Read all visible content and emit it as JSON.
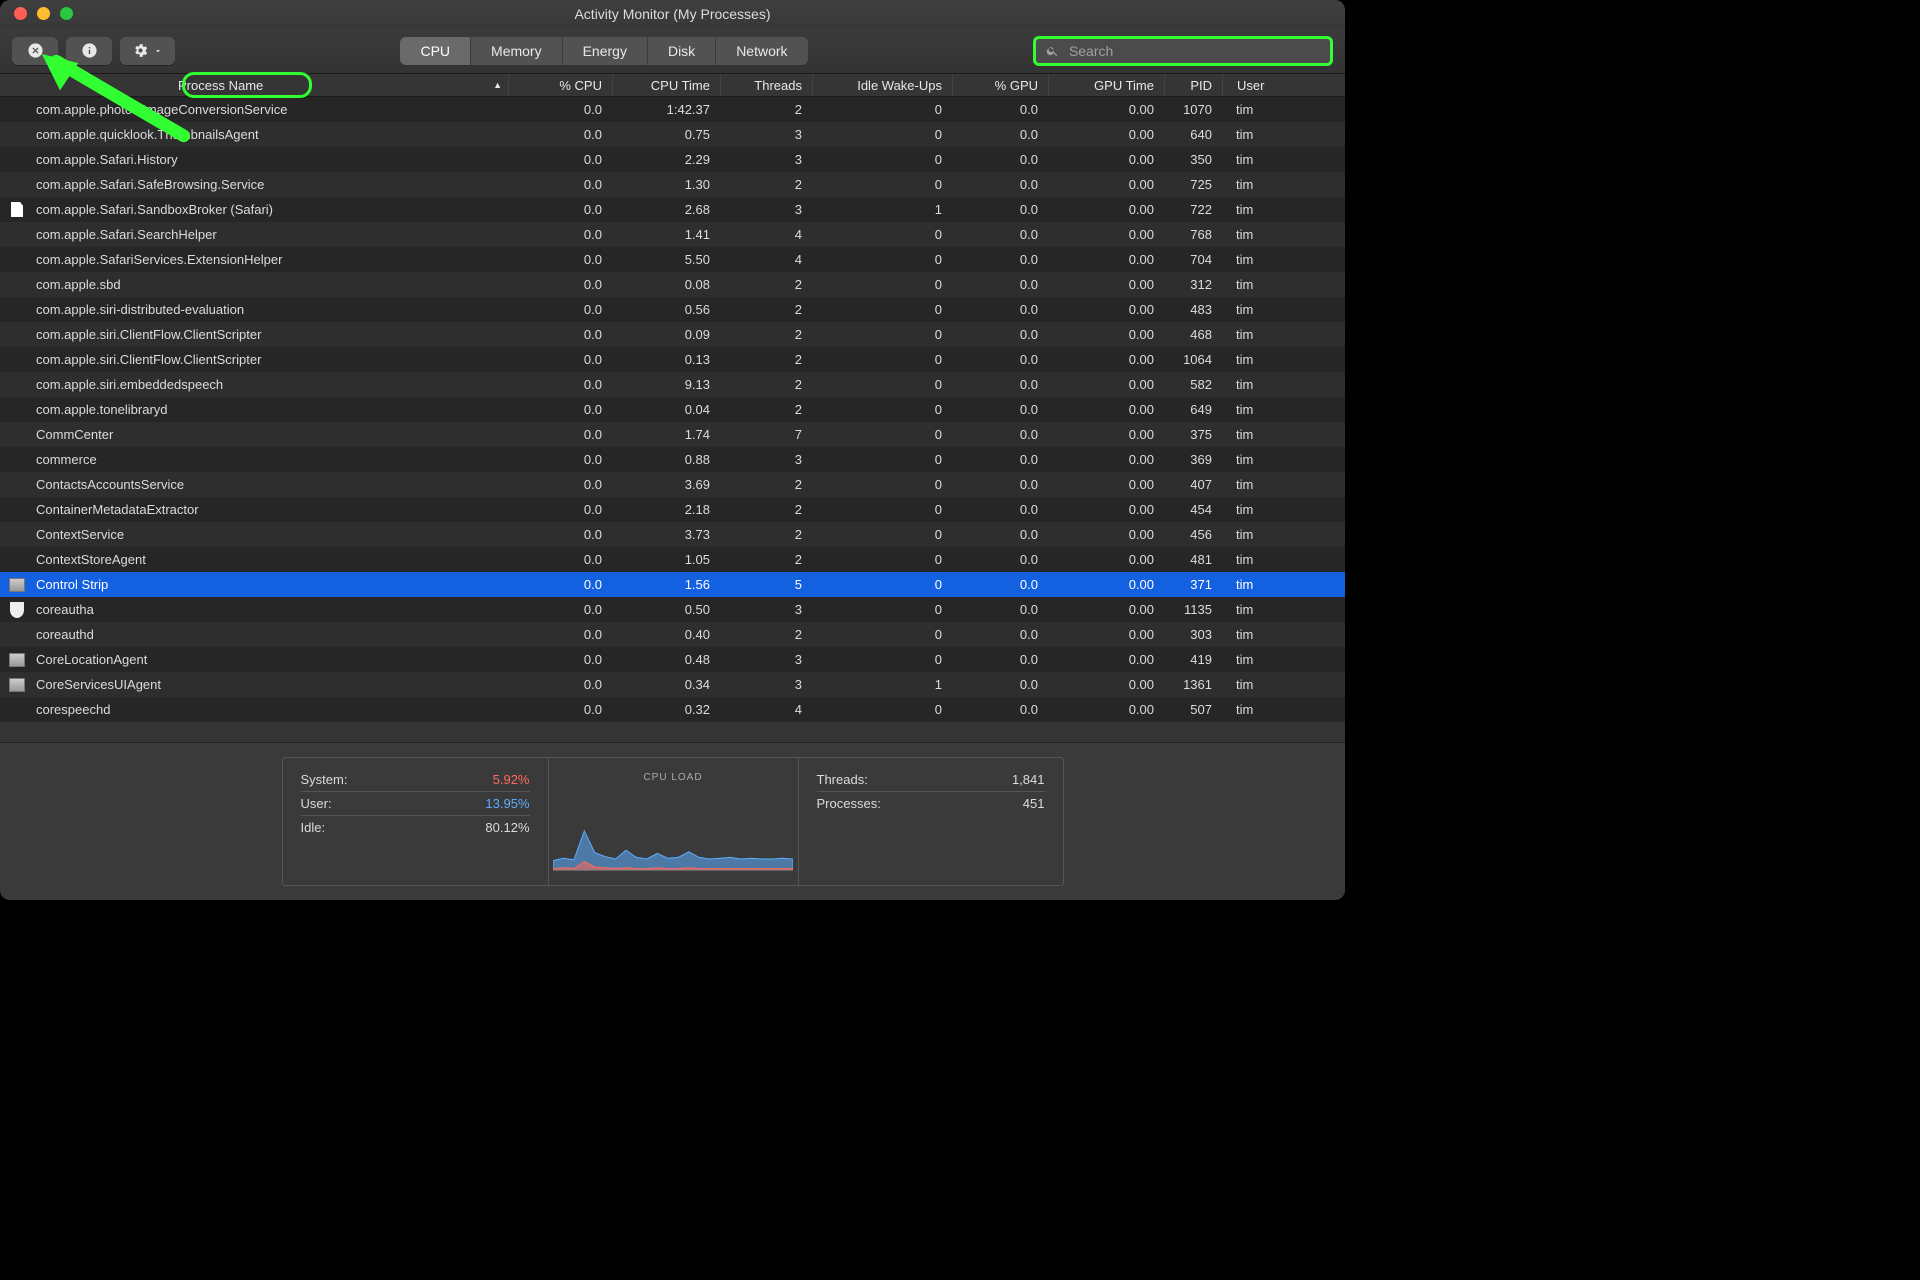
{
  "window_title": "Activity Monitor (My Processes)",
  "tabs": [
    "CPU",
    "Memory",
    "Energy",
    "Disk",
    "Network"
  ],
  "tabs_selected_index": 0,
  "search_placeholder": "Search",
  "columns": {
    "name": "Process Name",
    "cpu": "% CPU",
    "cputime": "CPU Time",
    "threads": "Threads",
    "wakeups": "Idle Wake-Ups",
    "gpu": "% GPU",
    "gputime": "GPU Time",
    "pid": "PID",
    "user": "User"
  },
  "sort_indicator": "▲",
  "processes": [
    {
      "icon": "",
      "name": "com.apple.photos.ImageConversionService",
      "cpu": "0.0",
      "cputime": "1:42.37",
      "threads": "2",
      "wakeups": "0",
      "gpu": "0.0",
      "gputime": "0.00",
      "pid": "1070",
      "user": "tim"
    },
    {
      "icon": "",
      "name": "com.apple.quicklook.ThumbnailsAgent",
      "cpu": "0.0",
      "cputime": "0.75",
      "threads": "3",
      "wakeups": "0",
      "gpu": "0.0",
      "gputime": "0.00",
      "pid": "640",
      "user": "tim"
    },
    {
      "icon": "",
      "name": "com.apple.Safari.History",
      "cpu": "0.0",
      "cputime": "2.29",
      "threads": "3",
      "wakeups": "0",
      "gpu": "0.0",
      "gputime": "0.00",
      "pid": "350",
      "user": "tim"
    },
    {
      "icon": "",
      "name": "com.apple.Safari.SafeBrowsing.Service",
      "cpu": "0.0",
      "cputime": "1.30",
      "threads": "2",
      "wakeups": "0",
      "gpu": "0.0",
      "gputime": "0.00",
      "pid": "725",
      "user": "tim"
    },
    {
      "icon": "doc",
      "name": "com.apple.Safari.SandboxBroker (Safari)",
      "cpu": "0.0",
      "cputime": "2.68",
      "threads": "3",
      "wakeups": "1",
      "gpu": "0.0",
      "gputime": "0.00",
      "pid": "722",
      "user": "tim"
    },
    {
      "icon": "",
      "name": "com.apple.Safari.SearchHelper",
      "cpu": "0.0",
      "cputime": "1.41",
      "threads": "4",
      "wakeups": "0",
      "gpu": "0.0",
      "gputime": "0.00",
      "pid": "768",
      "user": "tim"
    },
    {
      "icon": "",
      "name": "com.apple.SafariServices.ExtensionHelper",
      "cpu": "0.0",
      "cputime": "5.50",
      "threads": "4",
      "wakeups": "0",
      "gpu": "0.0",
      "gputime": "0.00",
      "pid": "704",
      "user": "tim"
    },
    {
      "icon": "",
      "name": "com.apple.sbd",
      "cpu": "0.0",
      "cputime": "0.08",
      "threads": "2",
      "wakeups": "0",
      "gpu": "0.0",
      "gputime": "0.00",
      "pid": "312",
      "user": "tim"
    },
    {
      "icon": "",
      "name": "com.apple.siri-distributed-evaluation",
      "cpu": "0.0",
      "cputime": "0.56",
      "threads": "2",
      "wakeups": "0",
      "gpu": "0.0",
      "gputime": "0.00",
      "pid": "483",
      "user": "tim"
    },
    {
      "icon": "",
      "name": "com.apple.siri.ClientFlow.ClientScripter",
      "cpu": "0.0",
      "cputime": "0.09",
      "threads": "2",
      "wakeups": "0",
      "gpu": "0.0",
      "gputime": "0.00",
      "pid": "468",
      "user": "tim"
    },
    {
      "icon": "",
      "name": "com.apple.siri.ClientFlow.ClientScripter",
      "cpu": "0.0",
      "cputime": "0.13",
      "threads": "2",
      "wakeups": "0",
      "gpu": "0.0",
      "gputime": "0.00",
      "pid": "1064",
      "user": "tim"
    },
    {
      "icon": "",
      "name": "com.apple.siri.embeddedspeech",
      "cpu": "0.0",
      "cputime": "9.13",
      "threads": "2",
      "wakeups": "0",
      "gpu": "0.0",
      "gputime": "0.00",
      "pid": "582",
      "user": "tim"
    },
    {
      "icon": "",
      "name": "com.apple.tonelibraryd",
      "cpu": "0.0",
      "cputime": "0.04",
      "threads": "2",
      "wakeups": "0",
      "gpu": "0.0",
      "gputime": "0.00",
      "pid": "649",
      "user": "tim"
    },
    {
      "icon": "",
      "name": "CommCenter",
      "cpu": "0.0",
      "cputime": "1.74",
      "threads": "7",
      "wakeups": "0",
      "gpu": "0.0",
      "gputime": "0.00",
      "pid": "375",
      "user": "tim"
    },
    {
      "icon": "",
      "name": "commerce",
      "cpu": "0.0",
      "cputime": "0.88",
      "threads": "3",
      "wakeups": "0",
      "gpu": "0.0",
      "gputime": "0.00",
      "pid": "369",
      "user": "tim"
    },
    {
      "icon": "",
      "name": "ContactsAccountsService",
      "cpu": "0.0",
      "cputime": "3.69",
      "threads": "2",
      "wakeups": "0",
      "gpu": "0.0",
      "gputime": "0.00",
      "pid": "407",
      "user": "tim"
    },
    {
      "icon": "",
      "name": "ContainerMetadataExtractor",
      "cpu": "0.0",
      "cputime": "2.18",
      "threads": "2",
      "wakeups": "0",
      "gpu": "0.0",
      "gputime": "0.00",
      "pid": "454",
      "user": "tim"
    },
    {
      "icon": "",
      "name": "ContextService",
      "cpu": "0.0",
      "cputime": "3.73",
      "threads": "2",
      "wakeups": "0",
      "gpu": "0.0",
      "gputime": "0.00",
      "pid": "456",
      "user": "tim"
    },
    {
      "icon": "",
      "name": "ContextStoreAgent",
      "cpu": "0.0",
      "cputime": "1.05",
      "threads": "2",
      "wakeups": "0",
      "gpu": "0.0",
      "gputime": "0.00",
      "pid": "481",
      "user": "tim"
    },
    {
      "icon": "chart",
      "selected": true,
      "name": "Control Strip",
      "cpu": "0.0",
      "cputime": "1.56",
      "threads": "5",
      "wakeups": "0",
      "gpu": "0.0",
      "gputime": "0.00",
      "pid": "371",
      "user": "tim"
    },
    {
      "icon": "shield",
      "name": "coreautha",
      "cpu": "0.0",
      "cputime": "0.50",
      "threads": "3",
      "wakeups": "0",
      "gpu": "0.0",
      "gputime": "0.00",
      "pid": "1135",
      "user": "tim"
    },
    {
      "icon": "",
      "name": "coreauthd",
      "cpu": "0.0",
      "cputime": "0.40",
      "threads": "2",
      "wakeups": "0",
      "gpu": "0.0",
      "gputime": "0.00",
      "pid": "303",
      "user": "tim"
    },
    {
      "icon": "chart",
      "name": "CoreLocationAgent",
      "cpu": "0.0",
      "cputime": "0.48",
      "threads": "3",
      "wakeups": "0",
      "gpu": "0.0",
      "gputime": "0.00",
      "pid": "419",
      "user": "tim"
    },
    {
      "icon": "chart",
      "name": "CoreServicesUIAgent",
      "cpu": "0.0",
      "cputime": "0.34",
      "threads": "3",
      "wakeups": "1",
      "gpu": "0.0",
      "gputime": "0.00",
      "pid": "1361",
      "user": "tim"
    },
    {
      "icon": "",
      "name": "corespeechd",
      "cpu": "0.0",
      "cputime": "0.32",
      "threads": "4",
      "wakeups": "0",
      "gpu": "0.0",
      "gputime": "0.00",
      "pid": "507",
      "user": "tim"
    }
  ],
  "footer": {
    "system_label": "System:",
    "system_value": "5.92%",
    "user_label": "User:",
    "user_value": "13.95%",
    "idle_label": "Idle:",
    "idle_value": "80.12%",
    "chart_title": "CPU LOAD",
    "threads_label": "Threads:",
    "threads_value": "1,841",
    "processes_label": "Processes:",
    "processes_value": "451"
  },
  "chart_data": {
    "type": "area",
    "title": "CPU LOAD",
    "xlabel": "",
    "ylabel": "",
    "ylim": [
      0,
      100
    ],
    "series": [
      {
        "name": "System",
        "color": "#ff6b5a",
        "values": [
          3,
          4,
          3,
          12,
          5,
          4,
          3,
          4,
          3,
          3,
          4,
          3,
          3,
          4,
          3,
          3,
          3,
          3,
          3,
          3,
          3,
          3,
          3,
          3
        ]
      },
      {
        "name": "User",
        "color": "#5dadff",
        "values": [
          10,
          12,
          11,
          38,
          18,
          14,
          12,
          22,
          14,
          12,
          18,
          13,
          14,
          20,
          14,
          12,
          13,
          14,
          12,
          13,
          12,
          12,
          13,
          12
        ]
      }
    ]
  }
}
